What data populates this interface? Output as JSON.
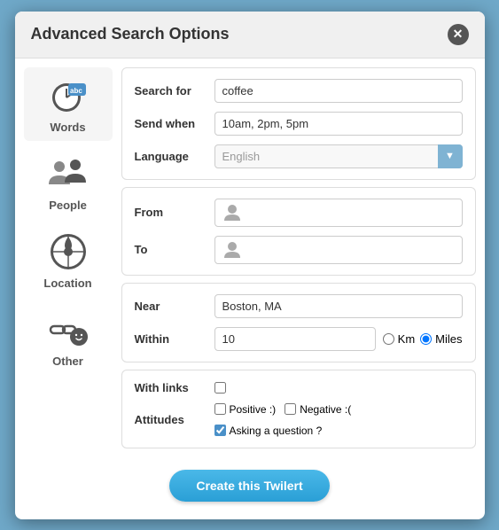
{
  "modal": {
    "title": "Advanced Search Options",
    "close_label": "✕"
  },
  "sidebar": {
    "items": [
      {
        "id": "words",
        "label": "Words",
        "icon": "words"
      },
      {
        "id": "people",
        "label": "People",
        "icon": "people"
      },
      {
        "id": "location",
        "label": "Location",
        "icon": "location"
      },
      {
        "id": "other",
        "label": "Other",
        "icon": "other"
      }
    ]
  },
  "sections": {
    "words": {
      "search_for_label": "Search for",
      "search_for_value": "coffee",
      "send_when_label": "Send when",
      "send_when_value": "10am, 2pm, 5pm",
      "language_label": "Language",
      "language_placeholder": "English"
    },
    "people": {
      "from_label": "From",
      "to_label": "To"
    },
    "location": {
      "near_label": "Near",
      "near_value": "Boston, MA",
      "within_label": "Within",
      "within_value": "10",
      "unit_km": "Km",
      "unit_miles": "Miles"
    },
    "other": {
      "with_links_label": "With links",
      "attitudes_label": "Attitudes",
      "positive_label": "Positive :)",
      "negative_label": "Negative :(",
      "asking_label": "Asking a question ?"
    }
  },
  "actions": {
    "create_label": "Create this Twilert"
  }
}
